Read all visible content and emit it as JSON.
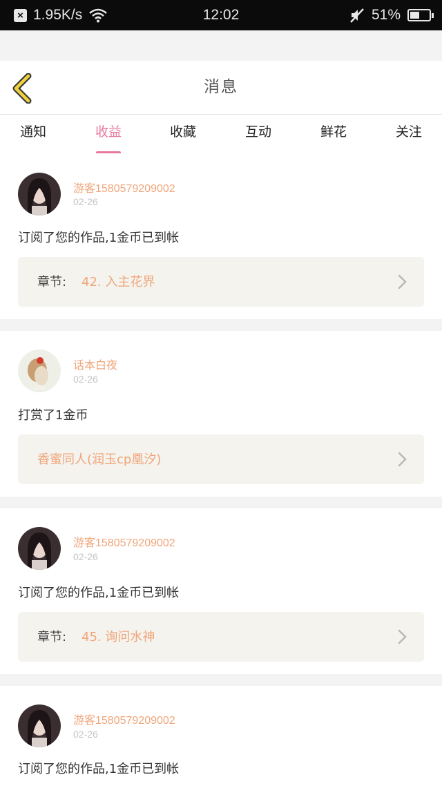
{
  "status_bar": {
    "network_speed": "1.95K/s",
    "time": "12:02",
    "battery_percent": "51%",
    "battery_level": 0.51
  },
  "header": {
    "title": "消息",
    "back_icon": "chevron-left-icon",
    "accent_color": "#f2d23c"
  },
  "tabs": [
    {
      "label": "通知",
      "active": false
    },
    {
      "label": "收益",
      "active": true
    },
    {
      "label": "收藏",
      "active": false
    },
    {
      "label": "互动",
      "active": false
    },
    {
      "label": "鲜花",
      "active": false
    },
    {
      "label": "关注",
      "active": false
    }
  ],
  "colors": {
    "active_tab": "#e8779b",
    "username": "#f0a57a",
    "link_value": "#f0a57a"
  },
  "messages": [
    {
      "username": "游客1580579209002",
      "date": "02-26",
      "text": "订阅了您的作品,1金币已到帐",
      "detail_label": "章节:",
      "detail_value": "42. 入主花界"
    },
    {
      "username": "话本白夜",
      "date": "02-26",
      "text": "打赏了1金币",
      "detail_label": "",
      "detail_value": "香蜜同人(润玉cp凰汐)"
    },
    {
      "username": "游客1580579209002",
      "date": "02-26",
      "text": "订阅了您的作品,1金币已到帐",
      "detail_label": "章节:",
      "detail_value": "45. 询问水神"
    },
    {
      "username": "游客1580579209002",
      "date": "02-26",
      "text": "订阅了您的作品,1金币已到帐"
    }
  ]
}
